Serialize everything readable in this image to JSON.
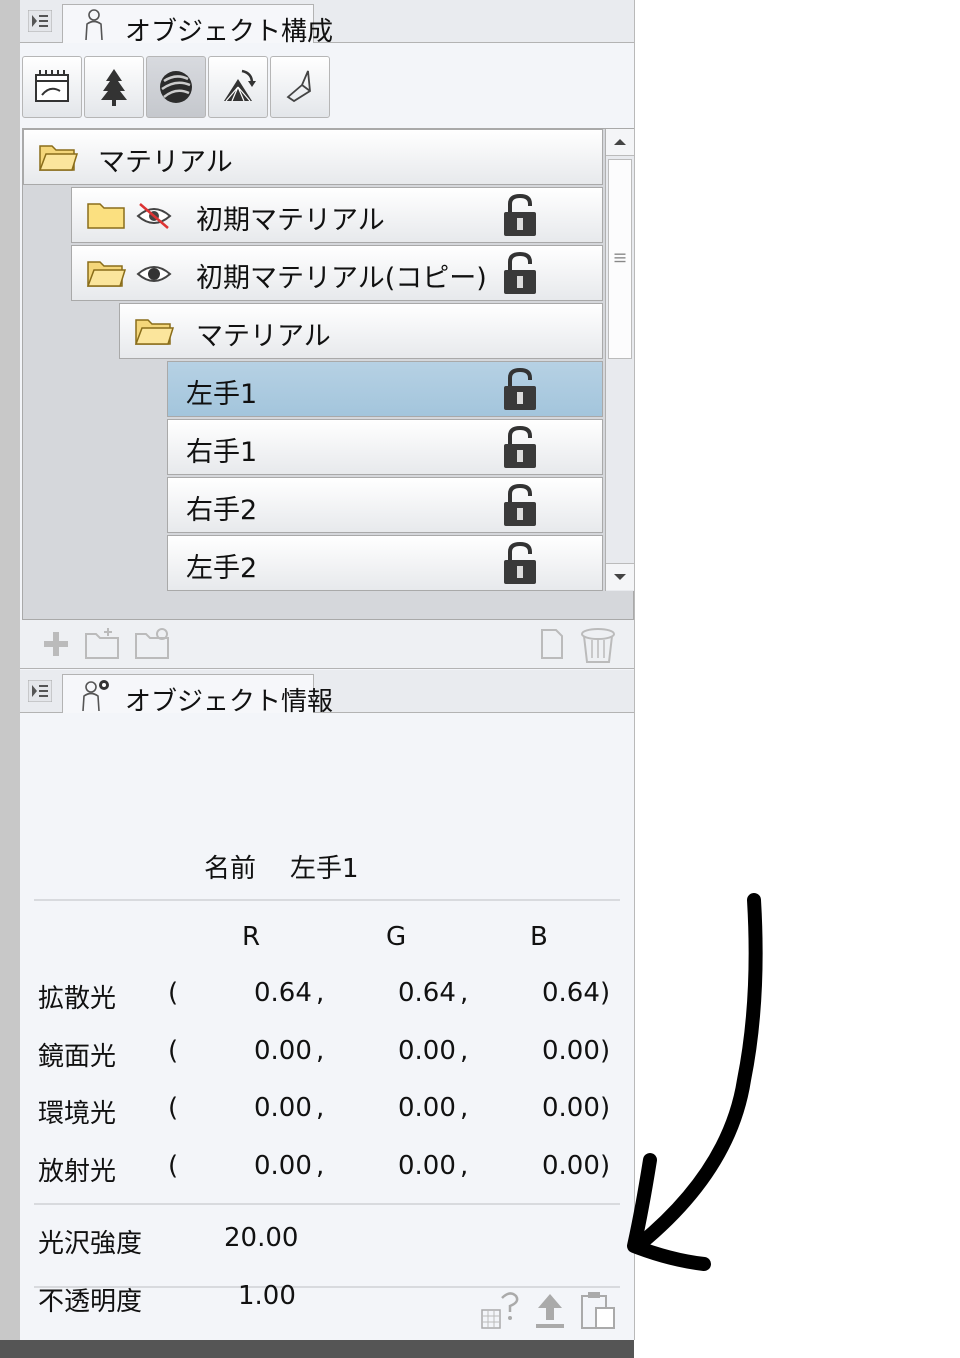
{
  "object_composition": {
    "tab_label": "オブジェクト構成",
    "tree": [
      {
        "label": "マテリアル",
        "level": 0,
        "folder": true
      },
      {
        "label": "初期マテリアル",
        "level": 1,
        "folder": true,
        "visible": false,
        "lock": true
      },
      {
        "label": "初期マテリアル(コピー)",
        "level": 1,
        "folder": true,
        "visible": true,
        "lock": true
      },
      {
        "label": "マテリアル",
        "level": 2,
        "folder": true
      },
      {
        "label": "左手1",
        "level": 3,
        "selected": true,
        "lock": true
      },
      {
        "label": "右手1",
        "level": 3,
        "lock": true
      },
      {
        "label": "右手2",
        "level": 3,
        "lock": true
      },
      {
        "label": "左手2",
        "level": 3,
        "lock": true
      }
    ]
  },
  "object_info": {
    "tab_label": "オブジェクト情報",
    "name_label": "名前",
    "name_value": "左手1",
    "headers": {
      "r": "R",
      "g": "G",
      "b": "B"
    },
    "rows": [
      {
        "label": "拡散光",
        "open": "(",
        "r": "0.64",
        "sep1": ",",
        "g": "0.64",
        "sep2": ",",
        "b": "0.64",
        "close": ")"
      },
      {
        "label": "鏡面光",
        "open": "(",
        "r": "0.00",
        "sep1": ",",
        "g": "0.00",
        "sep2": ",",
        "b": "0.00",
        "close": ")"
      },
      {
        "label": "環境光",
        "open": "(",
        "r": "0.00",
        "sep1": ",",
        "g": "0.00",
        "sep2": ",",
        "b": "0.00",
        "close": ")"
      },
      {
        "label": "放射光",
        "open": "(",
        "r": "0.00",
        "sep1": ",",
        "g": "0.00",
        "sep2": ",",
        "b": "0.00",
        "close": ")"
      }
    ],
    "gloss_label": "光沢強度",
    "gloss_value": "20.00",
    "opacity_label": "不透明度",
    "opacity_value": "1.00"
  },
  "colors": {
    "selected_row": "#a9c8de",
    "panel_bg": "#f3f5f9"
  }
}
